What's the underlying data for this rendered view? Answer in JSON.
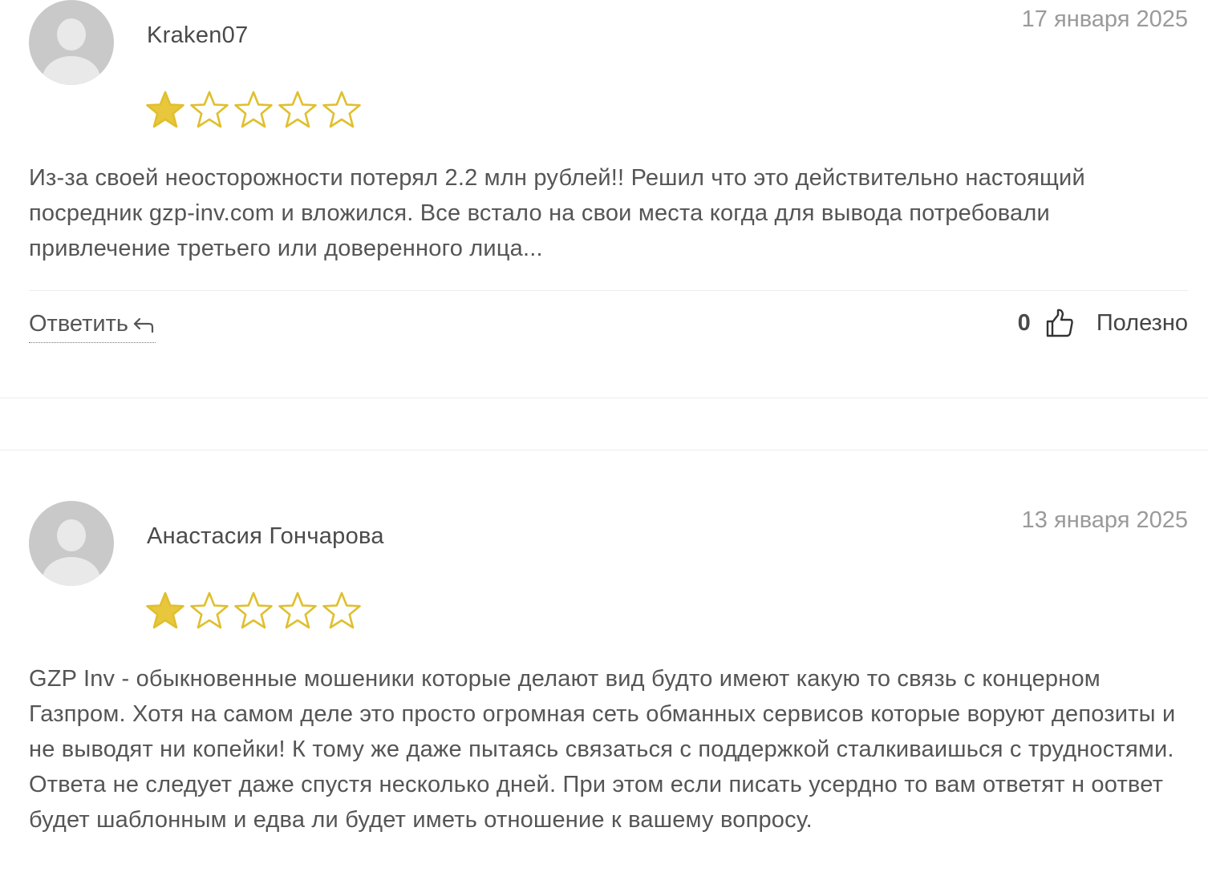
{
  "reviews": [
    {
      "author": "Kraken07",
      "date": "17 января 2025",
      "rating": 1,
      "rating_max": 5,
      "text": "Из-за своей неосторожности потерял 2.2 млн рублей!! Решил что это действительно настоящий посредник gzp-inv.com и вложился. Все встало на свои места когда для вывода потребовали привлечение третьего или доверенного лица...",
      "reply_label": "Ответить",
      "helpful_count": "0",
      "helpful_label": "Полезно"
    },
    {
      "author": "Анастасия Гончарова",
      "date": "13 января 2025",
      "rating": 1,
      "rating_max": 5,
      "text": "GZP Inv - обыкновенные мошеники которые делают вид будто имеют какую то связь с концерном Газпром. Хотя на самом деле это просто огромная сеть обманных сервисов которые воруют депозиты и не выводят ни копейки! К тому же даже пытаясь связаться с поддержкой сталкиваишься с трудностями. Ответа не следует даже спустя несколько дней. При этом если писать усердно то вам ответят н оответ будет шаблонным и едва ли будет иметь отношение к вашему вопросу."
    }
  ],
  "colors": {
    "star_fill": "#e8c73d",
    "star_stroke": "#e0bf2e",
    "text": "#555555",
    "date": "#9a9a9a",
    "avatar_bg": "#c9c9c9"
  },
  "icons": {
    "star_filled": "star-filled-icon",
    "star_empty": "star-empty-icon",
    "reply": "reply-arrow-icon",
    "thumb": "thumbs-up-icon",
    "avatar": "user-avatar-icon"
  }
}
